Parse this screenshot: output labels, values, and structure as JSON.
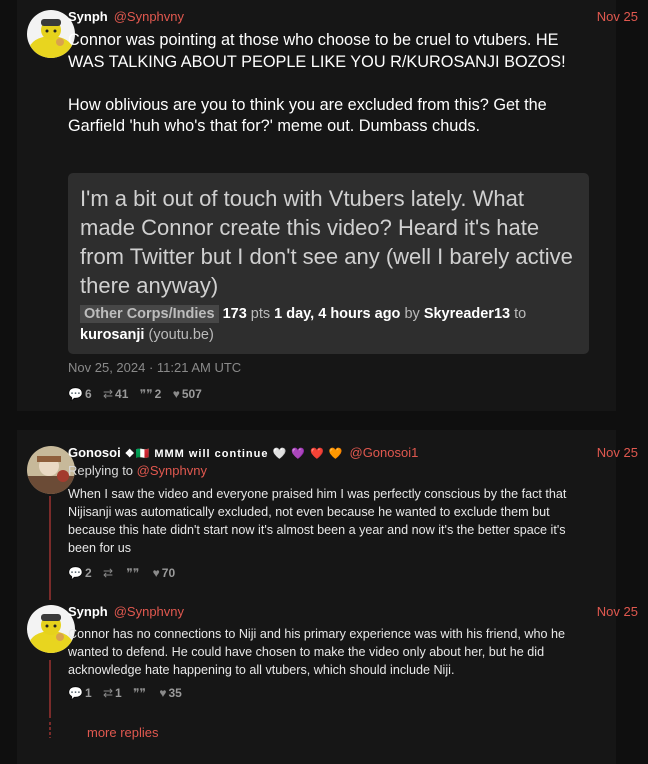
{
  "post1": {
    "username": "Synph",
    "handle": "@Synphvny",
    "date": "Nov 25",
    "text": "Connor was pointing at those who choose to be cruel to vtubers. HE WAS TALKING ABOUT PEOPLE LIKE YOU R/KUROSANJI BOZOS!\n\nHow oblivious are you to think you are excluded from this? Get the Garfield 'huh who's that for?' meme out. Dumbass chuds.",
    "quote": {
      "title": "I'm a bit out of touch with Vtubers lately. What made Connor create this video? Heard it's hate from Twitter but I don't see any (well I barely active there anyway)",
      "flair": "Other Corps/Indies",
      "points": "173",
      "points_unit": "pts",
      "age": "1 day, 4 hours ago",
      "by": "by",
      "author": "Skyreader13",
      "to": "to",
      "subreddit": "kurosanji",
      "domain": "(youtu.be)"
    },
    "timestamp": "Nov 25, 2024 · 11:21 AM UTC",
    "stats": {
      "replies": "6",
      "retweets": "41",
      "quotes": "2",
      "likes": "507"
    }
  },
  "reply1": {
    "username": "Gonosoi",
    "badges": "❖🇮🇹 MMM will continue 🤍 💜 ❤️ 🧡",
    "handle": "@Gonosoi1",
    "date": "Nov 25",
    "replying_label": "Replying to",
    "replying_handle": "@Synphvny",
    "text": "When I saw the video and everyone praised him I was perfectly conscious by the fact that Nijisanji was automatically excluded, not even because he wanted to exclude them but because this hate didn't start now it's almost been a year and now it's the better space it's been for us",
    "stats": {
      "replies": "2",
      "retweets": "",
      "quotes": "",
      "likes": "70"
    }
  },
  "reply2": {
    "username": "Synph",
    "handle": "@Synphvny",
    "date": "Nov 25",
    "text": "Connor has no connections to Niji and his primary experience was with his friend, who he wanted to defend. He could have chosen to make the video only about her, but he did acknowledge hate happening to all  vtubers, which should include Niji.",
    "stats": {
      "replies": "1",
      "retweets": "1",
      "quotes": "",
      "likes": "35"
    }
  },
  "more_replies": "more replies",
  "icons": [
    "comment-icon",
    "retweet-icon",
    "quote-icon",
    "heart-icon"
  ],
  "colors": {
    "accent": "#e0584f",
    "background": "#0f0f0f",
    "card": "#161616",
    "quote_bg": "#2e2e2e"
  }
}
